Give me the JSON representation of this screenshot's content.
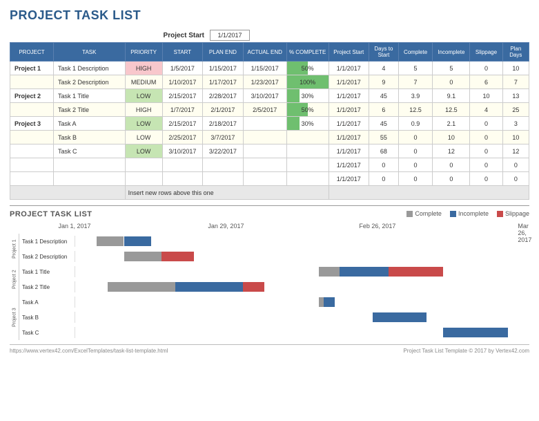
{
  "title": "PROJECT TASK LIST",
  "projectStart": {
    "label": "Project Start",
    "value": "1/1/2017"
  },
  "columns": [
    "PROJECT",
    "TASK",
    "PRIORITY",
    "START",
    "PLAN END",
    "ACTUAL END",
    "% COMPLETE",
    "Project Start",
    "Days to Start",
    "Complete",
    "Incomplete",
    "Slippage",
    "Plan Days"
  ],
  "rows": [
    {
      "project": "Project 1",
      "task": "Task 1 Description",
      "priority": "HIGH",
      "start": "1/5/2017",
      "planEnd": "1/15/2017",
      "actualEnd": "1/15/2017",
      "pct": 50,
      "pStart": "1/1/2017",
      "daysToStart": 4,
      "complete": 5,
      "incomplete": 5,
      "slippage": 0,
      "planDays": 10,
      "alt": false
    },
    {
      "project": "",
      "task": "Task 2 Description",
      "priority": "MEDIUM",
      "start": "1/10/2017",
      "planEnd": "1/17/2017",
      "actualEnd": "1/23/2017",
      "pct": 100,
      "pStart": "1/1/2017",
      "daysToStart": 9,
      "complete": 7,
      "incomplete": 0,
      "slippage": 6,
      "planDays": 7,
      "alt": true
    },
    {
      "project": "Project 2",
      "task": "Task 1 Title",
      "priority": "LOW",
      "start": "2/15/2017",
      "planEnd": "2/28/2017",
      "actualEnd": "3/10/2017",
      "pct": 30,
      "pStart": "1/1/2017",
      "daysToStart": 45,
      "complete": 3.9,
      "incomplete": 9.1,
      "slippage": 10,
      "planDays": 13,
      "alt": false
    },
    {
      "project": "",
      "task": "Task 2 Title",
      "priority": "HIGH",
      "start": "1/7/2017",
      "planEnd": "2/1/2017",
      "actualEnd": "2/5/2017",
      "pct": 50,
      "pStart": "1/1/2017",
      "daysToStart": 6,
      "complete": 12.5,
      "incomplete": 12.5,
      "slippage": 4,
      "planDays": 25,
      "alt": true
    },
    {
      "project": "Project 3",
      "task": "Task A",
      "priority": "LOW",
      "start": "2/15/2017",
      "planEnd": "2/18/2017",
      "actualEnd": "",
      "pct": 30,
      "pStart": "1/1/2017",
      "daysToStart": 45,
      "complete": 0.9,
      "incomplete": 2.1,
      "slippage": 0,
      "planDays": 3,
      "alt": false
    },
    {
      "project": "",
      "task": "Task B",
      "priority": "LOW",
      "start": "2/25/2017",
      "planEnd": "3/7/2017",
      "actualEnd": "",
      "pct": null,
      "pStart": "1/1/2017",
      "daysToStart": 55,
      "complete": 0,
      "incomplete": 10,
      "slippage": 0,
      "planDays": 10,
      "alt": true
    },
    {
      "project": "",
      "task": "Task C",
      "priority": "LOW",
      "start": "3/10/2017",
      "planEnd": "3/22/2017",
      "actualEnd": "",
      "pct": null,
      "pStart": "1/1/2017",
      "daysToStart": 68,
      "complete": 0,
      "incomplete": 12,
      "slippage": 0,
      "planDays": 12,
      "alt": false
    }
  ],
  "emptyRows": [
    {
      "pStart": "1/1/2017",
      "daysToStart": 0,
      "complete": 0,
      "incomplete": 0,
      "slippage": 0,
      "planDays": 0
    },
    {
      "pStart": "1/1/2017",
      "daysToStart": 0,
      "complete": 0,
      "incomplete": 0,
      "slippage": 0,
      "planDays": 0
    }
  ],
  "noteRow": "Insert new rows above this one",
  "chart": {
    "title": "PROJECT TASK LIST",
    "legend": {
      "complete": "Complete",
      "incomplete": "Incomplete",
      "slippage": "Slippage"
    },
    "timelineLabels": [
      "Jan 1, 2017",
      "Jan 29, 2017",
      "Feb 26, 2017",
      "Mar 26, 2017"
    ],
    "projectGroups": [
      {
        "name": "Project 1",
        "tasks": [
          "Task 1 Description",
          "Task 2 Description"
        ]
      },
      {
        "name": "Project 2",
        "tasks": [
          "Task 1 Title",
          "Task 2 Title"
        ]
      },
      {
        "name": "Project 3",
        "tasks": [
          "Task A",
          "Task B",
          "Task C"
        ]
      }
    ]
  },
  "footer": {
    "left": "https://www.vertex42.com/ExcelTemplates/task-list-template.html",
    "right": "Project Task List Template © 2017 by Vertex42.com"
  },
  "chart_data": {
    "type": "bar",
    "title": "PROJECT TASK LIST",
    "xlabel": "",
    "ylabel": "",
    "categories": [
      "Task 1 Description",
      "Task 2 Description",
      "Task 1 Title",
      "Task 2 Title",
      "Task A",
      "Task B",
      "Task C"
    ],
    "x_start_days": [
      4,
      9,
      45,
      6,
      45,
      55,
      68
    ],
    "series": [
      {
        "name": "Complete",
        "values": [
          5,
          7,
          3.9,
          12.5,
          0.9,
          0,
          0
        ]
      },
      {
        "name": "Incomplete",
        "values": [
          5,
          0,
          9.1,
          12.5,
          2.1,
          10,
          12
        ]
      },
      {
        "name": "Slippage",
        "values": [
          0,
          6,
          10,
          4,
          0,
          0,
          0
        ]
      }
    ],
    "x_axis_dates": [
      "2017-01-01",
      "2017-01-29",
      "2017-02-26",
      "2017-03-26"
    ],
    "xlim_days": [
      0,
      84
    ]
  }
}
